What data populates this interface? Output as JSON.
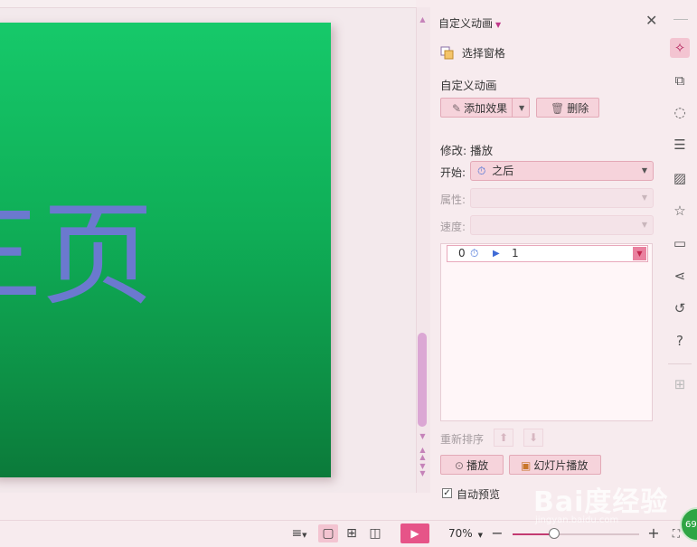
{
  "slide": {
    "text": "三页"
  },
  "panel": {
    "title": "自定义动画",
    "selection_pane": "选择窗格",
    "section_title": "自定义动画",
    "add_effect": "添加效果",
    "delete": "删除",
    "modify_label": "修改: 播放",
    "start_label": "开始:",
    "start_value": "之后",
    "property_label": "属性:",
    "speed_label": "速度:",
    "list": [
      {
        "index": "0",
        "name": "1"
      }
    ],
    "reorder_label": "重新排序",
    "play": "播放",
    "slideshow": "幻灯片播放",
    "autopreview": "自动预览",
    "autopreview_checked": "✓"
  },
  "statusbar": {
    "zoom": "70%",
    "zoom_fraction": 0.33
  },
  "watermark": {
    "logo": "Bai度经验",
    "url": "jingyan.baidu.com"
  },
  "badge": "69",
  "colors": {
    "accent": "#e65488",
    "button_bg": "#f6d3db",
    "slide_green": "#14c066",
    "slide_text": "#6b79cf"
  }
}
